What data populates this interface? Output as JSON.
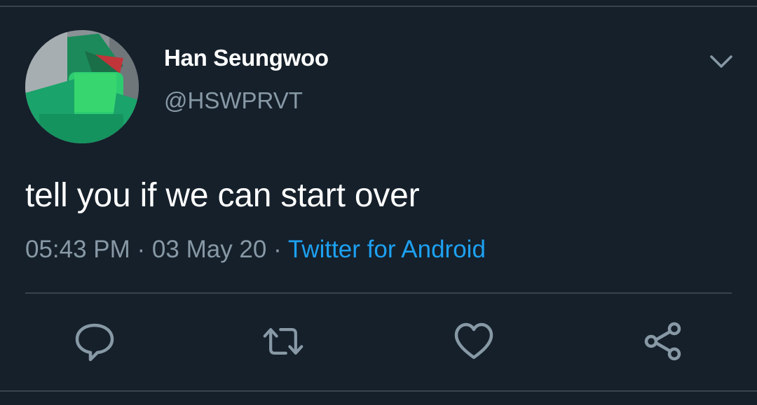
{
  "tweet": {
    "author": {
      "display_name": "Han Seungwoo",
      "handle": "@HSWPRVT"
    },
    "text": "tell you if we can start over",
    "time": "05:43 PM",
    "date": "03 May 20",
    "separator": " · ",
    "source": "Twitter for Android"
  },
  "icons": {
    "menu": "chevron-down-icon",
    "reply": "speech-bubble-icon",
    "retweet": "retweet-icon",
    "like": "heart-icon",
    "share": "share-icon"
  },
  "colors": {
    "background": "#15202b",
    "text_primary": "#ffffff",
    "text_secondary": "#8899a6",
    "link": "#1da1f2",
    "border": "#38444d"
  }
}
